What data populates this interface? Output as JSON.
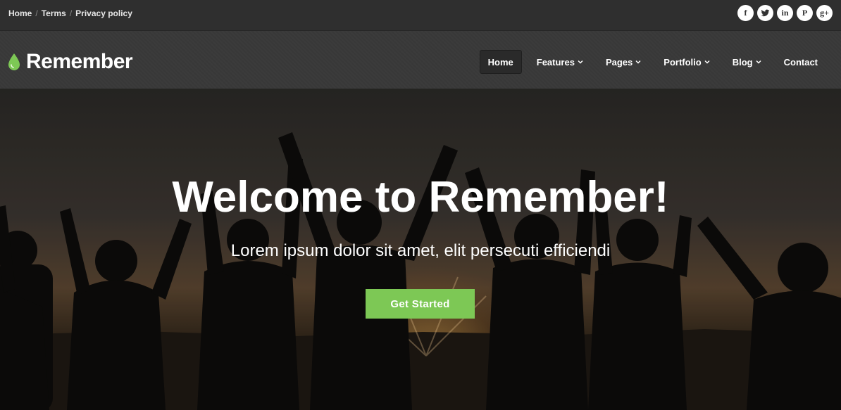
{
  "topbar": {
    "links": [
      {
        "label": "Home"
      },
      {
        "label": "Terms"
      },
      {
        "label": "Privacy policy"
      }
    ],
    "separator": "/",
    "socials": [
      {
        "icon": "facebook-icon",
        "glyph": "f"
      },
      {
        "icon": "twitter-icon",
        "glyph": ""
      },
      {
        "icon": "linkedin-icon",
        "glyph": "in"
      },
      {
        "icon": "pinterest-icon",
        "glyph": "P"
      },
      {
        "icon": "google-plus-icon",
        "glyph": "g+"
      }
    ]
  },
  "header": {
    "logo_text": "Remember",
    "logo_icon": "droplet-icon",
    "nav": [
      {
        "label": "Home",
        "active": true
      },
      {
        "label": "Features",
        "dropdown": true
      },
      {
        "label": "Pages",
        "dropdown": true
      },
      {
        "label": "Portfolio",
        "dropdown": true
      },
      {
        "label": "Blog",
        "dropdown": true
      },
      {
        "label": "Contact"
      }
    ]
  },
  "hero": {
    "title": "Welcome to Remember!",
    "subtitle": "Lorem ipsum dolor sit amet, elit persecuti efficiendi",
    "cta_label": "Get Started"
  },
  "colors": {
    "accent": "#7dc855",
    "topbar_bg": "#2f2f2f",
    "header_bg": "#3a3a3a"
  }
}
